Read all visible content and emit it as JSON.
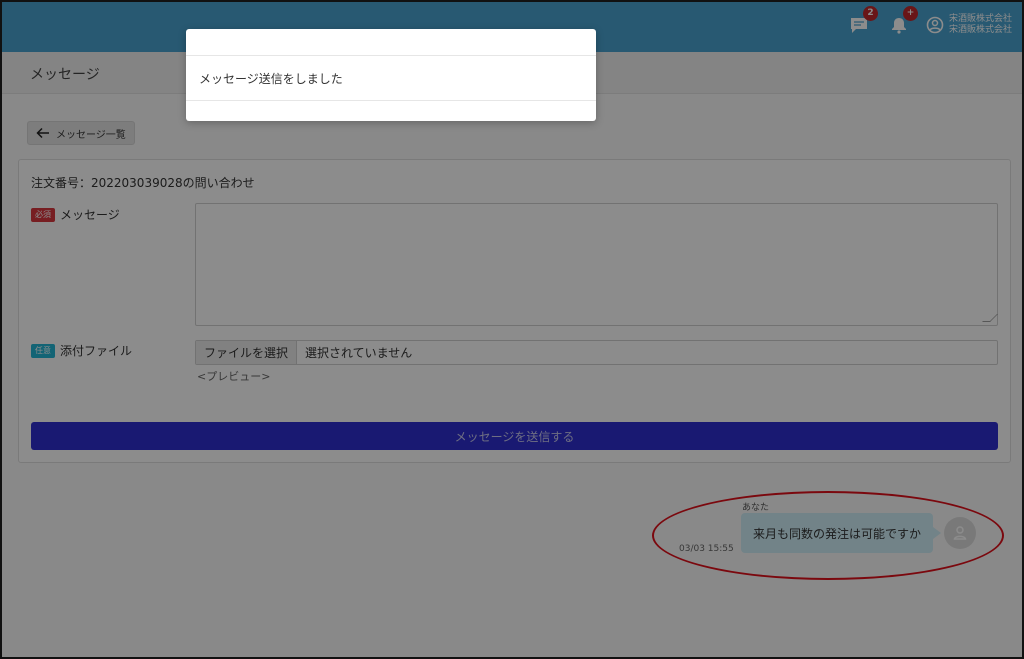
{
  "header": {
    "message_badge": "2",
    "notification_badge": "+",
    "company_line1": "宋酒販株式会社",
    "company_line2": "宋酒販株式会社",
    "colors": {
      "bar": "#4aa3cf",
      "badge": "#c0282c"
    }
  },
  "page": {
    "title": "メッセージ",
    "back_label": "メッセージ一覧"
  },
  "form": {
    "order_title": "注文番号：202203039028の問い合わせ",
    "message_tag": "必須",
    "message_label": "メッセージ",
    "message_value": "",
    "attach_tag": "任意",
    "attach_label": "添付ファイル",
    "file_button": "ファイルを選択",
    "file_status": "選択されていません",
    "preview": "<プレビュー>",
    "send_button": "メッセージを送信する",
    "send_color": "#2f2fd0"
  },
  "chat": {
    "sender": "あなた",
    "timestamp": "03/03 15:55",
    "text": "来月も同数の発注は可能ですか"
  },
  "modal": {
    "message": "メッセージ送信をしました"
  }
}
